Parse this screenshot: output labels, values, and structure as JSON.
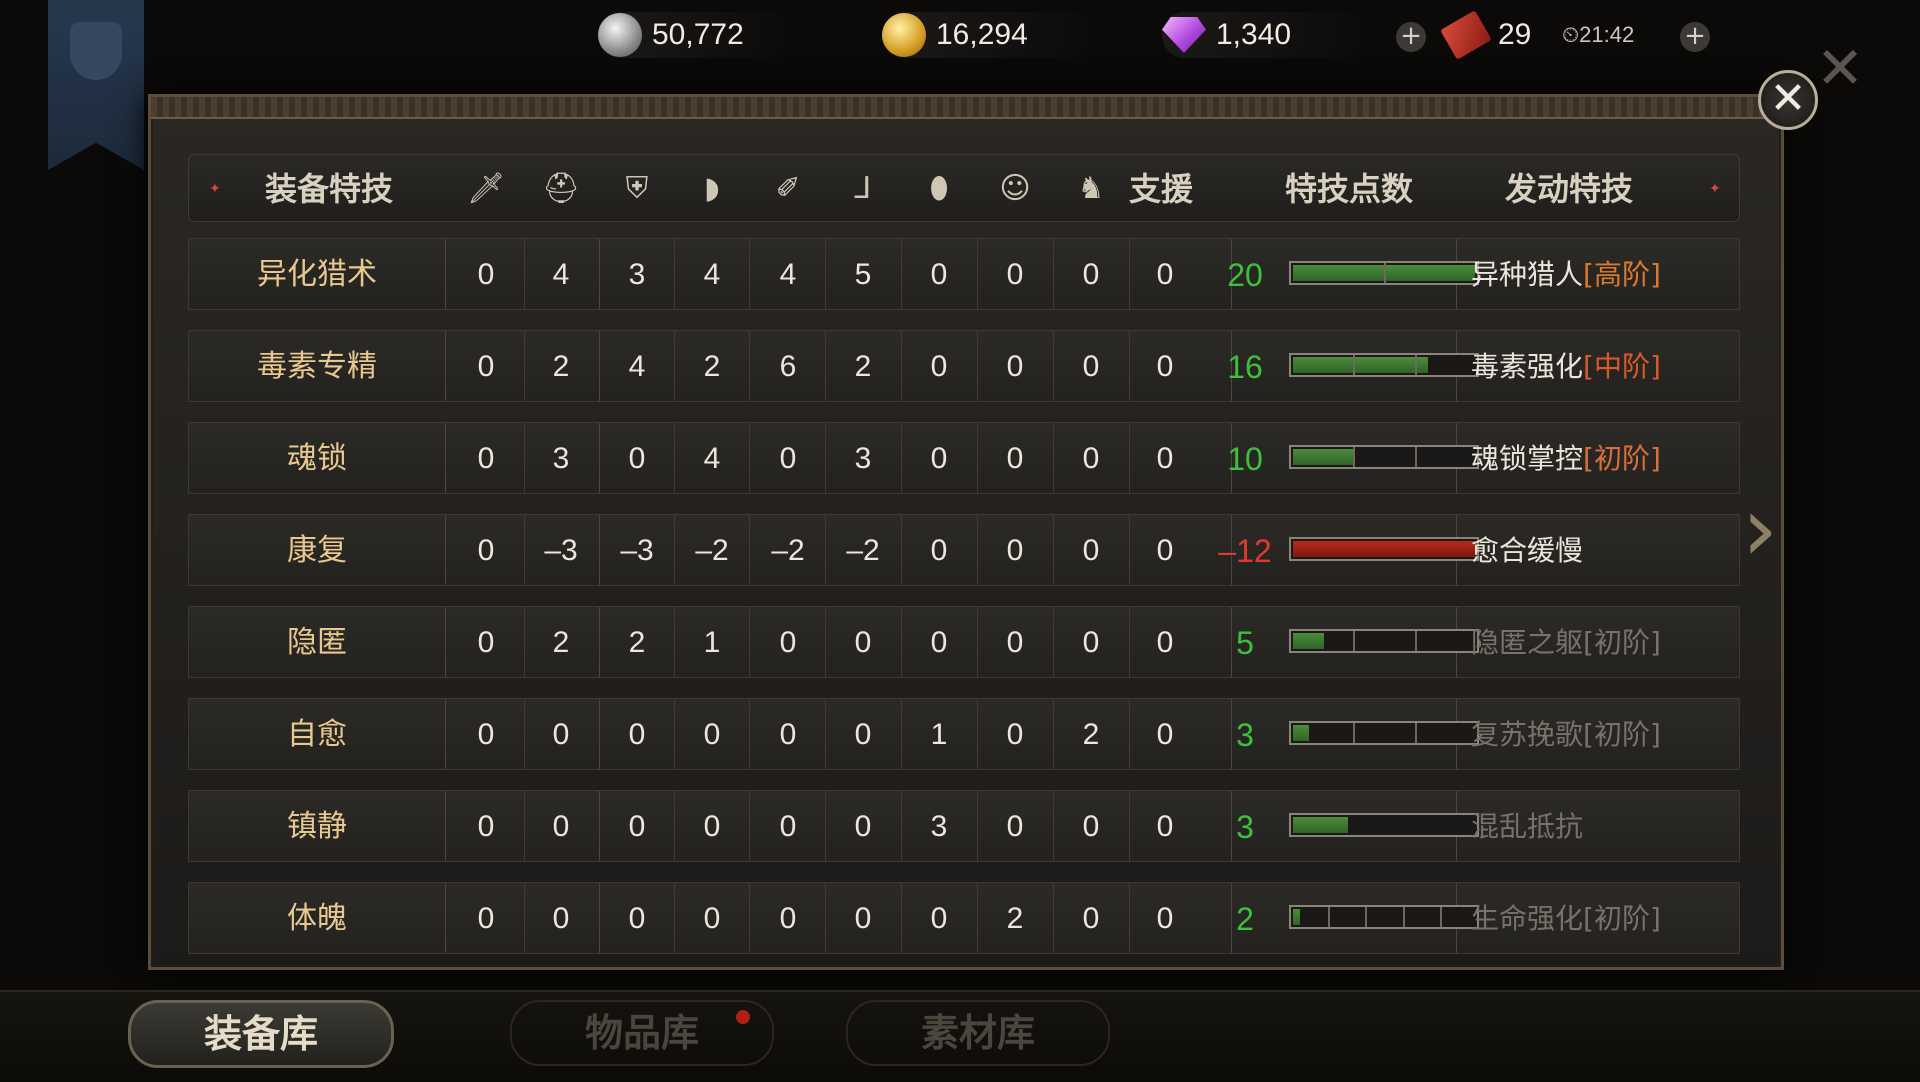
{
  "currencies": {
    "silver": {
      "icon": "silver-coin-icon",
      "value": "50,772"
    },
    "gold": {
      "icon": "gold-coin-icon",
      "value": "16,294"
    },
    "diamond": {
      "icon": "diamond-icon",
      "value": "1,340"
    },
    "ticket": {
      "icon": "ticket-icon",
      "value": "29"
    },
    "timer": "⏲21:42",
    "plus": "+"
  },
  "close_glyph": "✕",
  "outer_close_glyph": "✕",
  "next_glyph": "›",
  "header": {
    "skill_col": "装备特技",
    "support_col": "支援",
    "points_col": "特技点数",
    "active_col": "发动特技",
    "icons": [
      "sword-icon",
      "helmet-icon",
      "armor-icon",
      "shoulder-icon",
      "gauntlet-icon",
      "boots-icon",
      "ring-icon",
      "mask-icon",
      "horse-icon"
    ],
    "icon_glyphs": [
      "🗡",
      "⛑",
      "⛨",
      "◗",
      "✐",
      "⅃",
      "⬮",
      "☺",
      "♞"
    ],
    "star": "✦"
  },
  "rows": [
    {
      "name": "异化猎术",
      "values": [
        "0",
        "4",
        "3",
        "4",
        "4",
        "5",
        "0",
        "0",
        "0",
        "0"
      ],
      "points": "20",
      "level": 1.0,
      "ticks": 1,
      "bar": "green",
      "skill": "异种猎人",
      "tier": "[高阶]",
      "tier_class": "tier-high",
      "active": true
    },
    {
      "name": "毒素专精",
      "values": [
        "0",
        "2",
        "4",
        "2",
        "6",
        "2",
        "0",
        "0",
        "0",
        "0"
      ],
      "points": "16",
      "level": 0.74,
      "ticks": 2,
      "bar": "green",
      "skill": "毒素强化",
      "tier": "[中阶]",
      "tier_class": "tier-mid",
      "active": true
    },
    {
      "name": "魂锁",
      "values": [
        "0",
        "3",
        "0",
        "4",
        "0",
        "3",
        "0",
        "0",
        "0",
        "0"
      ],
      "points": "10",
      "level": 0.34,
      "ticks": 2,
      "bar": "green",
      "skill": "魂锁掌控",
      "tier": "[初阶]",
      "tier_class": "tier-low",
      "active": true
    },
    {
      "name": "康复",
      "values": [
        "0",
        "–3",
        "–3",
        "–2",
        "–2",
        "–2",
        "0",
        "0",
        "0",
        "0"
      ],
      "points": "–12",
      "level": 1.0,
      "ticks": 0,
      "bar": "red",
      "skill": "愈合缓慢",
      "tier": "",
      "tier_class": "",
      "active": true
    },
    {
      "name": "隐匿",
      "values": [
        "0",
        "2",
        "2",
        "1",
        "0",
        "0",
        "0",
        "0",
        "0",
        "0"
      ],
      "points": "5",
      "level": 0.17,
      "ticks": 2,
      "bar": "green",
      "skill": "隐匿之躯",
      "tier": "[初阶]",
      "tier_class": "tier-low",
      "active": false
    },
    {
      "name": "自愈",
      "values": [
        "0",
        "0",
        "0",
        "0",
        "0",
        "0",
        "1",
        "0",
        "2",
        "0"
      ],
      "points": "3",
      "level": 0.09,
      "ticks": 2,
      "bar": "green",
      "skill": "复苏挽歌",
      "tier": "[初阶]",
      "tier_class": "tier-low",
      "active": false
    },
    {
      "name": "镇静",
      "values": [
        "0",
        "0",
        "0",
        "0",
        "0",
        "0",
        "3",
        "0",
        "0",
        "0"
      ],
      "points": "3",
      "level": 0.3,
      "ticks": 0,
      "bar": "green",
      "skill": "混乱抵抗",
      "tier": "",
      "tier_class": "",
      "active": false
    },
    {
      "name": "体魄",
      "values": [
        "0",
        "0",
        "0",
        "0",
        "0",
        "0",
        "0",
        "2",
        "0",
        "0"
      ],
      "points": "2",
      "level": 0.04,
      "ticks": 4,
      "bar": "green",
      "skill": "生命强化",
      "tier": "[初阶]",
      "tier_class": "tier-low",
      "active": false
    }
  ],
  "bottom_tabs": [
    {
      "label": "装备库",
      "active": true
    },
    {
      "label": "物品库",
      "active": false
    },
    {
      "label": "素材库",
      "active": false
    }
  ]
}
